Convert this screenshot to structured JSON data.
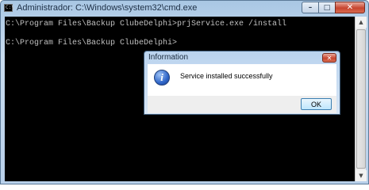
{
  "cmd_window": {
    "app_icon_text": "C:\\",
    "title": "Administrador: C:\\Windows\\system32\\cmd.exe",
    "window_buttons": {
      "minimize": "–",
      "maximize": "□",
      "close": "✕"
    },
    "console_lines": [
      "C:\\Program Files\\Backup ClubeDelphi>prjService.exe /install",
      "",
      "C:\\Program Files\\Backup ClubeDelphi>"
    ],
    "colors": {
      "console_background": "#000000",
      "console_text": "#c0c0c0"
    }
  },
  "dialog": {
    "title": "Information",
    "close_glyph": "✕",
    "icon": "information-icon",
    "icon_glyph": "i",
    "message": "Service installed successfully",
    "ok_label": "OK"
  },
  "scrollbar": {
    "up_glyph": "▲",
    "down_glyph": "▼"
  }
}
